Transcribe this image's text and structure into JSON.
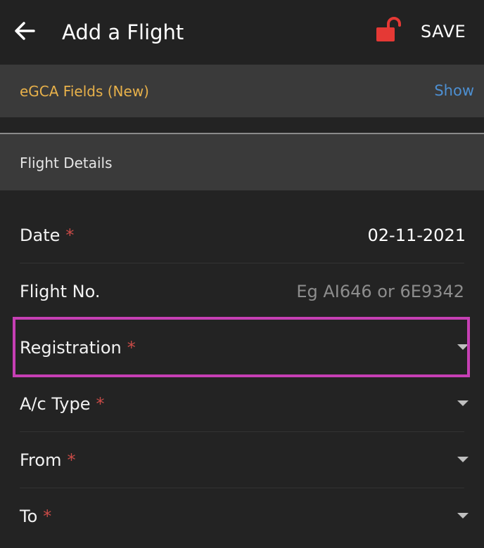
{
  "header": {
    "title": "Add a Flight",
    "save_label": "SAVE",
    "back_icon": "arrow-left-icon",
    "lock_icon": "unlock-icon",
    "lock_color": "#e53935"
  },
  "egca": {
    "label": "eGCA Fields (New)",
    "toggle_label": "Show",
    "label_color": "#e8b14a",
    "toggle_color": "#4d8fd1"
  },
  "section": {
    "title": "Flight Details"
  },
  "fields": [
    {
      "label": "Date",
      "required": "*",
      "value": "02-11-2021"
    },
    {
      "label": "Flight No.",
      "placeholder": "Eg AI646 or 6E9342"
    },
    {
      "label": "Registration",
      "required": "*",
      "highlighted": true,
      "highlight_color": "#c63fb4"
    },
    {
      "label": "A/c Type",
      "required": "*"
    },
    {
      "label": "From",
      "required": "*"
    },
    {
      "label": "To",
      "required": "*"
    }
  ]
}
